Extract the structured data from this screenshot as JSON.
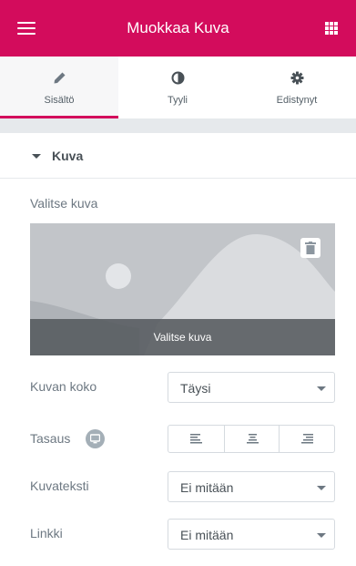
{
  "header": {
    "title": "Muokkaa Kuva"
  },
  "tabs": [
    {
      "label": "Sisältö",
      "icon": "pencil-icon",
      "active": true
    },
    {
      "label": "Tyyli",
      "icon": "half-circle-icon",
      "active": false
    },
    {
      "label": "Edistynyt",
      "icon": "gear-icon",
      "active": false
    }
  ],
  "section": {
    "title": "Kuva"
  },
  "image": {
    "label": "Valitse kuva",
    "choose_label": "Valitse kuva"
  },
  "fields": {
    "size": {
      "label": "Kuvan koko",
      "value": "Täysi"
    },
    "alignment": {
      "label": "Tasaus"
    },
    "caption": {
      "label": "Kuvateksti",
      "value": "Ei mitään"
    },
    "link": {
      "label": "Linkki",
      "value": "Ei mitään"
    }
  },
  "colors": {
    "accent": "#d30c5c",
    "text": "#6d7882",
    "border": "#d5dadf"
  }
}
